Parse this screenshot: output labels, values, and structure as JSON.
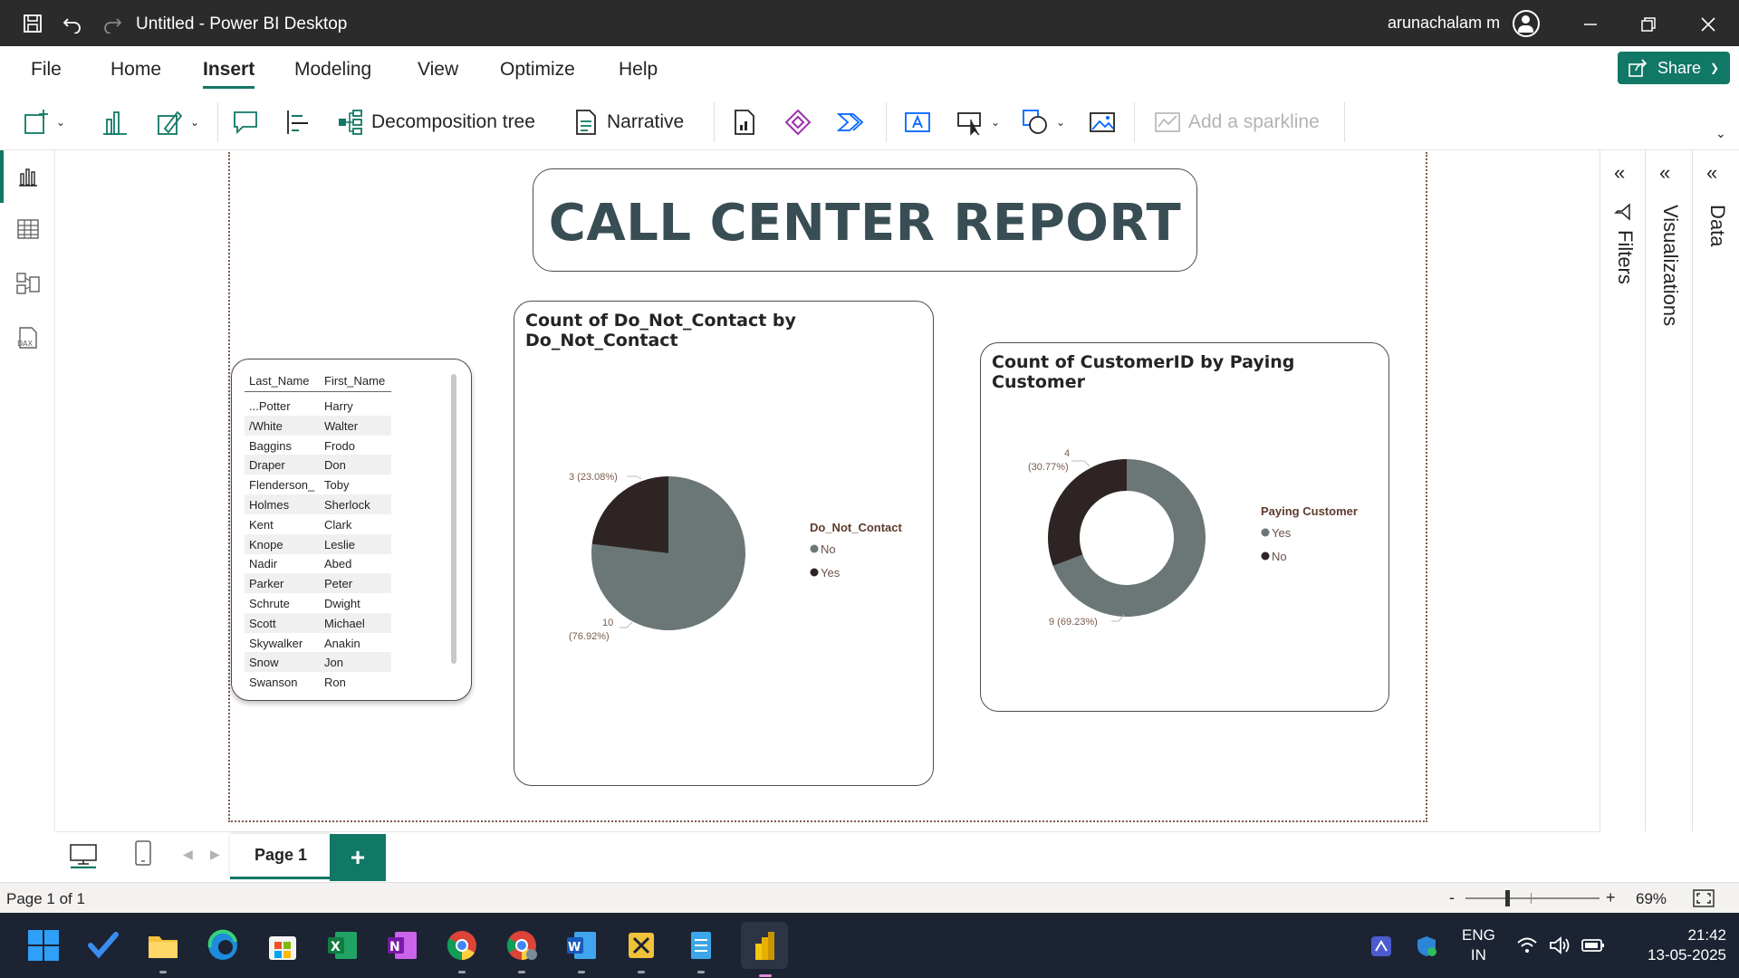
{
  "window": {
    "title": "Untitled - Power BI Desktop",
    "user": "arunachalam m"
  },
  "menu": {
    "tabs": [
      "File",
      "Home",
      "Insert",
      "Modeling",
      "View",
      "Optimize",
      "Help"
    ],
    "active": "Insert",
    "share_label": "Share"
  },
  "ribbon": {
    "decomposition_label": "Decomposition tree",
    "narrative_label": "Narrative",
    "sparkline_label": "Add a sparkline"
  },
  "report": {
    "title": "CALL CENTER REPORT"
  },
  "table": {
    "columns": [
      "Last_Name",
      "First_Name"
    ],
    "rows": [
      [
        "...Potter",
        "Harry"
      ],
      [
        "/White",
        "Walter"
      ],
      [
        "Baggins",
        "Frodo"
      ],
      [
        "Draper",
        "Don"
      ],
      [
        "Flenderson_",
        "Toby"
      ],
      [
        "Holmes",
        "Sherlock"
      ],
      [
        "Kent",
        "Clark"
      ],
      [
        "Knope",
        "Leslie"
      ],
      [
        "Nadir",
        "Abed"
      ],
      [
        "Parker",
        "Peter"
      ],
      [
        "Schrute",
        "Dwight"
      ],
      [
        "Scott",
        "Michael"
      ],
      [
        "Skywalker",
        "Anakin"
      ],
      [
        "Snow",
        "Jon"
      ],
      [
        "Swanson",
        "Ron"
      ]
    ]
  },
  "chart_data": [
    {
      "type": "pie",
      "title": "Count of Do_Not_Contact by Do_Not_Contact",
      "legend_title": "Do_Not_Contact",
      "categories": [
        "No",
        "Yes"
      ],
      "values": [
        10,
        3
      ],
      "percent_labels": [
        "(76.92%)",
        "3 (23.08%)"
      ],
      "value_labels": [
        "10",
        ""
      ],
      "colors": [
        "#6b7777",
        "#2f2424"
      ],
      "legend_placement": "right"
    },
    {
      "type": "donut",
      "title": "Count of CustomerID by Paying Customer",
      "legend_title": "Paying Customer",
      "categories": [
        "Yes",
        "No"
      ],
      "values": [
        9,
        4
      ],
      "data_labels": [
        "9 (69.23%)",
        "4",
        "(30.77%)"
      ],
      "colors": [
        "#6b7777",
        "#2f2424"
      ],
      "legend_placement": "right"
    }
  ],
  "panes": {
    "filters": "Filters",
    "visualizations": "Visualizations",
    "data": "Data"
  },
  "pages": {
    "tab": "Page 1",
    "add": "+"
  },
  "status": {
    "page_info": "Page 1 of 1",
    "zoom": "69%",
    "zoom_minus": "-",
    "zoom_plus": "+"
  },
  "taskbar": {
    "lang1": "ENG",
    "lang2": "IN",
    "time": "21:42",
    "date": "13-05-2025"
  }
}
